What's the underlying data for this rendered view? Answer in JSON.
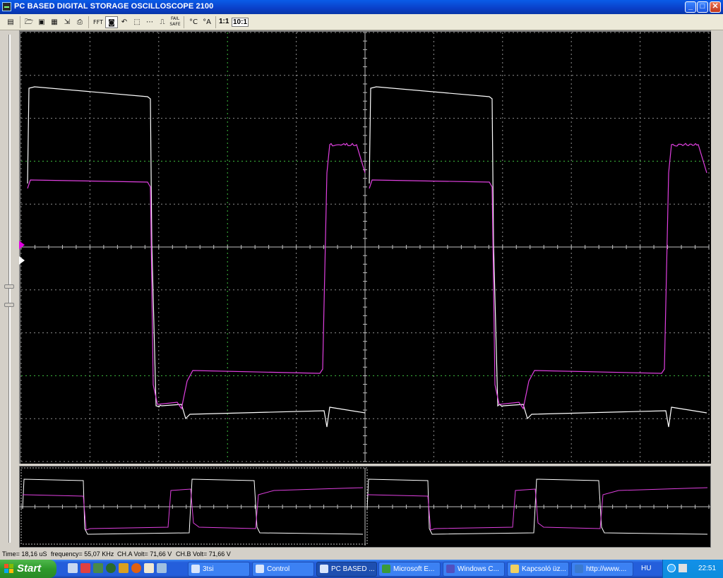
{
  "window": {
    "title": "PC BASED DIGITAL STORAGE OSCILLOSCOPE 2100",
    "minimize": "_",
    "maximize": "□",
    "close": "✕"
  },
  "toolbar": {
    "icons": [
      "scope-icon",
      "open-folder-icon",
      "save-icon",
      "display-icon",
      "export-icon",
      "print-icon",
      "fft-icon",
      "screen-icon",
      "undo-icon",
      "cursor-box-icon",
      "hline-icon",
      "waveform-icon",
      "fail-safe-icon",
      "temp-c-icon",
      "temp-a-icon"
    ],
    "fft_label": "FFT",
    "fail_safe_label": "FAIL SAFE",
    "ratio_1": "1:1",
    "ratio_10": "10:1"
  },
  "status": {
    "time": "Time= 18,16 uS",
    "frequency": "frequency= 55,07 KHz",
    "cha_volt": "CH.A Volt= 71,66 V",
    "chb_volt": "CH.B Volt= 71,66 V"
  },
  "colors": {
    "channel_a": "#e040e0",
    "channel_b": "#ffffff",
    "grid": "#909090",
    "grid_accent": "#40c040",
    "background": "#000000"
  },
  "taskbar": {
    "start_label": "Start",
    "tasks": [
      {
        "label": "3tsi",
        "active": false
      },
      {
        "label": "Control",
        "active": false
      },
      {
        "label": "PC BASED ...",
        "active": true
      },
      {
        "label": "Microsoft E...",
        "active": false
      },
      {
        "label": "Windows C...",
        "active": false
      },
      {
        "label": "Kapcsoló üz...",
        "active": false
      },
      {
        "label": "http://www....",
        "active": false
      }
    ],
    "language": "HU",
    "clock": "22:51"
  }
}
